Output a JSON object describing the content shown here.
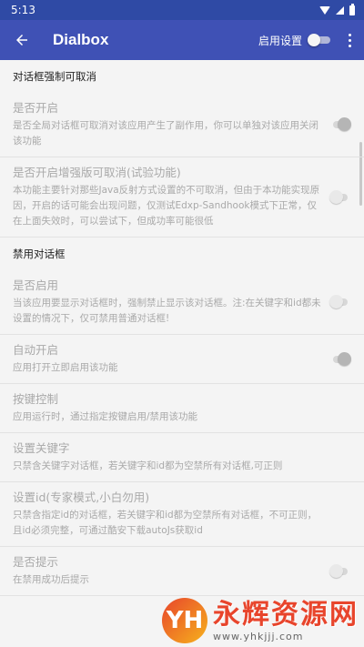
{
  "status_bar": {
    "time": "5:13"
  },
  "app_bar": {
    "title": "Dialbox",
    "enable_label": "启用设置",
    "enable_switch": false
  },
  "sections": [
    {
      "header": "对话框强制可取消",
      "items": [
        {
          "title": "是否开启",
          "desc": "是否全局对话框可取消对该应用产生了副作用，你可以单独对该应用关闭该功能",
          "switch": "on"
        },
        {
          "title": "是否开启增强版可取消(试验功能)",
          "desc": "本功能主要针对那些Java反射方式设置的不可取消，但由于本功能实现原因，开启的话可能会出现问题，仅测试Edxp-Sandhook模式下正常，仅在上面失效时，可以尝试下，但成功率可能很低",
          "switch": "off"
        }
      ]
    },
    {
      "header": "禁用对话框",
      "items": [
        {
          "title": "是否启用",
          "desc": "当该应用要显示对话框时，强制禁止显示该对话框。注:在关键字和id都未设置的情况下，仅可禁用普通对话框!",
          "switch": "off"
        },
        {
          "title": "自动开启",
          "desc": "应用打开立即启用该功能",
          "switch": "on"
        },
        {
          "title": "按键控制",
          "desc": "应用运行时，通过指定按键启用/禁用该功能",
          "switch": null
        },
        {
          "title": "设置关键字",
          "desc": "只禁含关键字对话框，若关键字和id都为空禁所有对话框,可正则",
          "switch": null
        },
        {
          "title": "设置id(专家模式,小白勿用)",
          "desc": "只禁含指定id的对话框，若关键字和id都为空禁所有对话框，不可正则，且id必须完整，可通过酷安下载autoJs获取id",
          "switch": null
        },
        {
          "title": "是否提示",
          "desc": "在禁用成功后提示",
          "switch": "off"
        }
      ]
    }
  ],
  "watermark": {
    "logo_text": "YH",
    "name": "永辉资源网",
    "url": "www.yhkjjj.com"
  }
}
